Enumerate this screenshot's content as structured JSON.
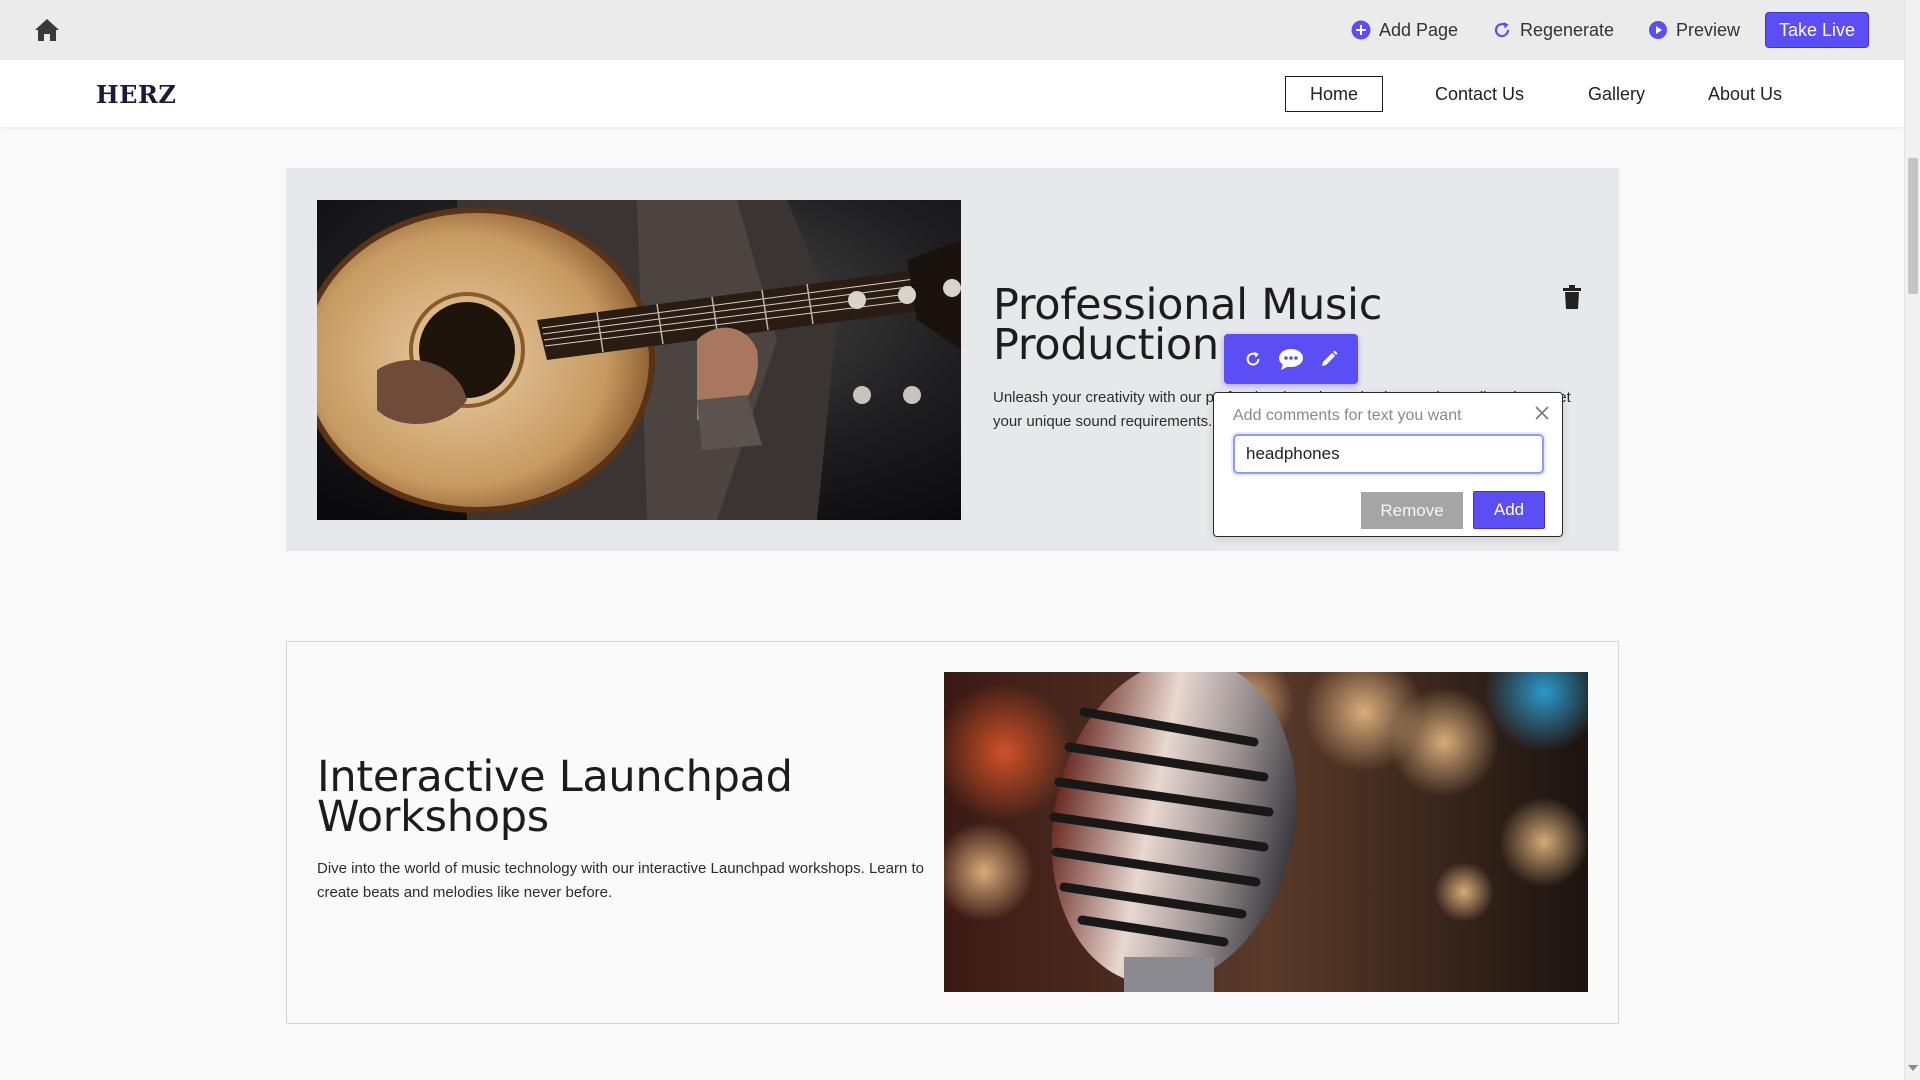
{
  "toolbar": {
    "home_icon": "home-icon",
    "add_page_label": "Add Page",
    "regenerate_label": "Regenerate",
    "preview_label": "Preview",
    "take_live_label": "Take Live",
    "accent_color": "#5b4ef5"
  },
  "site": {
    "logo": "HERZ",
    "nav": [
      {
        "label": "Home",
        "active": true
      },
      {
        "label": "Contact Us"
      },
      {
        "label": "Gallery"
      },
      {
        "label": "About Us"
      }
    ]
  },
  "section1": {
    "title": "Professional Music Production",
    "description": "Unleash your creativity with our professional music production services tailored to meet your unique sound requirements.",
    "image": "guitar-player-photo",
    "delete_icon": "trash-icon"
  },
  "edit_tools": [
    "refresh-icon",
    "comment-icon",
    "pencil-icon"
  ],
  "comment_popup": {
    "placeholder": "Add comments for text you want",
    "input_value": "headphones",
    "remove_label": "Remove",
    "add_label": "Add",
    "close_icon": "close-icon"
  },
  "section2": {
    "title": "Interactive Launchpad Workshops",
    "description": "Dive into the world of music technology with our interactive Launchpad workshops. Learn to create beats and melodies like never before.",
    "image": "vintage-microphone-photo"
  }
}
